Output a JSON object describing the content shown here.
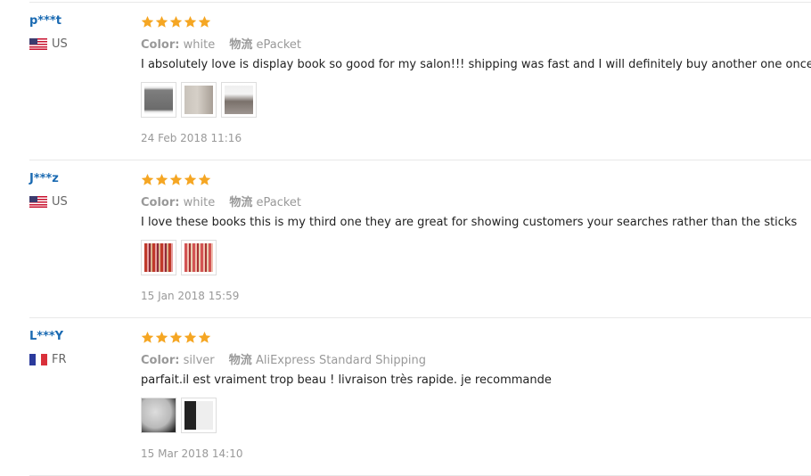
{
  "meta_labels": {
    "color": "Color:",
    "shipping": "物流"
  },
  "reviews": [
    {
      "user": "p***t",
      "country": "US",
      "color": "white",
      "shipping": "ePacket",
      "text": "I absolutely love is display book so good for my salon!!! shipping was fast and I will definitely buy another one once this one is full",
      "photos": [
        "white-book-photo",
        "white-book-photo",
        "white-book-photo"
      ],
      "date": "24 Feb 2018 11:16",
      "stars": 5
    },
    {
      "user": "J***z",
      "country": "US",
      "color": "white",
      "shipping": "ePacket",
      "text": "I love these books this is my third one they are great for showing customers your searches rather than the sticks",
      "photos": [
        "color-swatch-photo",
        "color-swatch-photo"
      ],
      "date": "15 Jan 2018 15:59",
      "stars": 5
    },
    {
      "user": "L***Y",
      "country": "FR",
      "color": "silver",
      "shipping": "AliExpress Standard Shipping",
      "text": "parfait.il est vraiment trop beau ! livraison très rapide. je recommande",
      "photos": [
        "silver-book-photo",
        "silver-book-photo"
      ],
      "date": "15 Mar 2018 14:10",
      "stars": 5
    }
  ],
  "colors": {
    "star": "#f5a623",
    "username": "#1a6ab2"
  }
}
